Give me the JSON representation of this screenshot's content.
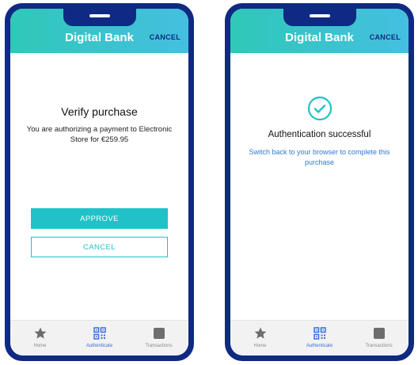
{
  "brand": {
    "name": "Digital Bank",
    "cancel_label": "CANCEL",
    "accent": "#20c2c7",
    "frame": "#0f2a82"
  },
  "verify": {
    "title": "Verify purchase",
    "description": "You are authorizing a payment to Electronic Store for €259.95",
    "approve_label": "APPROVE",
    "cancel_label": "CANCEL"
  },
  "success": {
    "title": "Authentication successful",
    "message": "Switch back to your browser to complete this purchase",
    "icon": "check-circle-icon"
  },
  "tabs": [
    {
      "label": "Home",
      "icon": "star-icon"
    },
    {
      "label": "Authenticate",
      "icon": "qr-code-icon",
      "active": true
    },
    {
      "label": "Transactions",
      "icon": "square-icon"
    }
  ]
}
